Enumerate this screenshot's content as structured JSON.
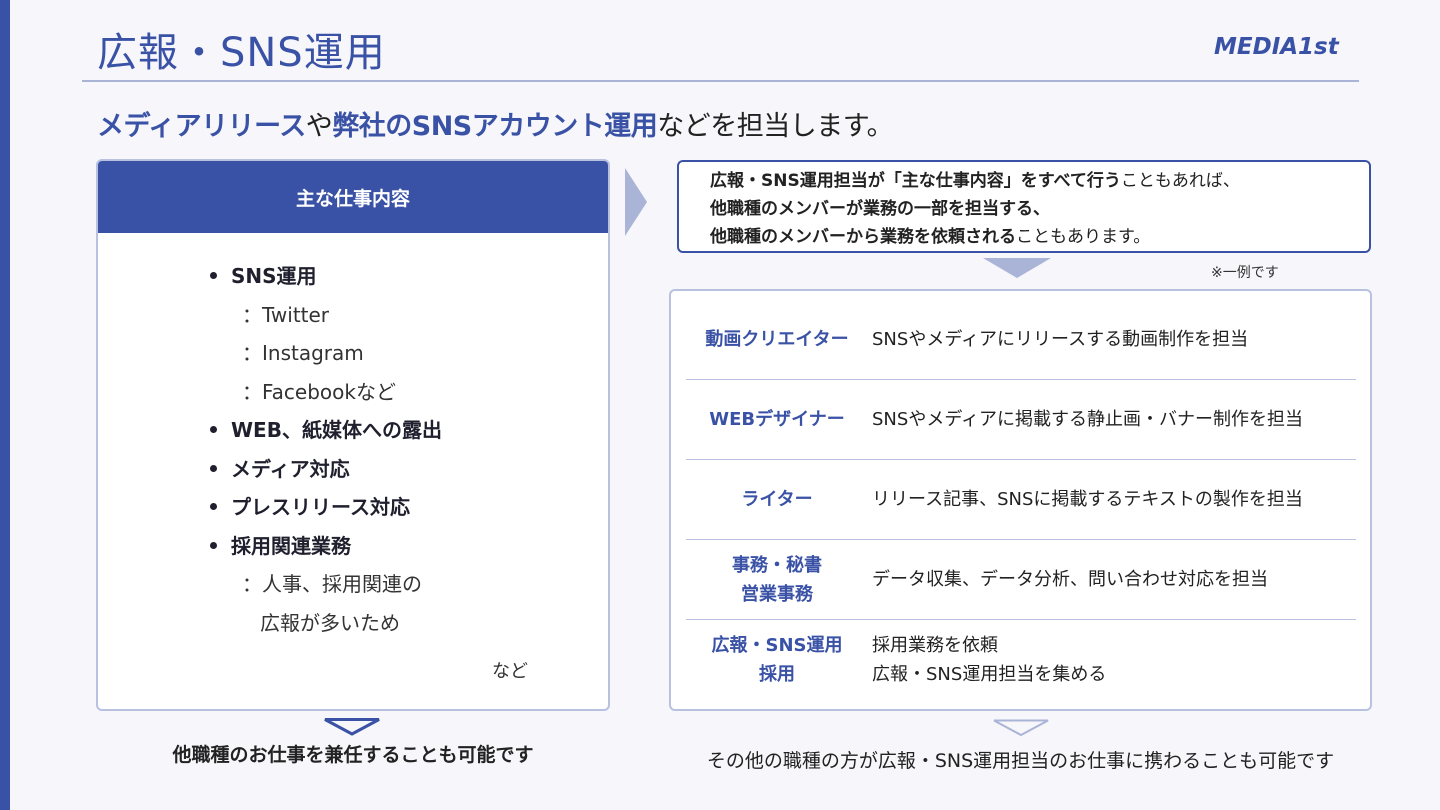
{
  "header": {
    "title": "広報・SNS運用",
    "logo": "MEDIA1st"
  },
  "subtitle": {
    "part1": "メディアリリース",
    "part2": "や",
    "part3": "弊社のSNSアカウント運用",
    "part4": "などを担当します。"
  },
  "left_panel": {
    "header": "主な仕事内容",
    "items": [
      {
        "text": "SNS運用"
      },
      {
        "text": "：Twitter"
      },
      {
        "text": "：Instagram"
      },
      {
        "text": "：Facebookなど"
      },
      {
        "text": "WEB、紙媒体への露出"
      },
      {
        "text": "メディア対応"
      },
      {
        "text": "プレスリリース対応"
      },
      {
        "text": "採用関連業務"
      },
      {
        "text": "：人事、採用関連の"
      },
      {
        "text": "広報が多いため"
      }
    ],
    "etc": "など"
  },
  "top_right": {
    "line1_bold": "広報・SNS運用担当が「主な仕事内容」をすべて行う",
    "line1_rest": "こともあれば、",
    "line2_bold": "他職種のメンバーが業務の一部を担当する、",
    "line3_bold": "他職種のメンバーから業務を依頼される",
    "line3_rest": "こともあります。",
    "note": "※一例です"
  },
  "roles": [
    {
      "name1": "動画クリエイター",
      "name2": "",
      "desc1": "SNSやメディアにリリースする動画制作を担当",
      "desc2": ""
    },
    {
      "name1": "WEBデザイナー",
      "name2": "",
      "desc1": "SNSやメディアに掲載する静止画・バナー制作を担当",
      "desc2": ""
    },
    {
      "name1": "ライター",
      "name2": "",
      "desc1": "リリース記事、SNSに掲載するテキストの製作を担当",
      "desc2": ""
    },
    {
      "name1": "事務・秘書",
      "name2": "営業事務",
      "desc1": "データ収集、データ分析、問い合わせ対応を担当",
      "desc2": ""
    },
    {
      "name1": "広報・SNS運用",
      "name2": "採用",
      "desc1": "採用業務を依頼",
      "desc2": "広報・SNS運用担当を集める"
    }
  ],
  "bottom": {
    "left": "他職種のお仕事を兼任することも可能です",
    "right": "その他の職種の方が広報・SNS運用担当のお仕事に携わることも可能です"
  },
  "colors": {
    "accent": "#3a52a6",
    "border_light": "#b9c1e0",
    "background": "#f6f6fb"
  }
}
